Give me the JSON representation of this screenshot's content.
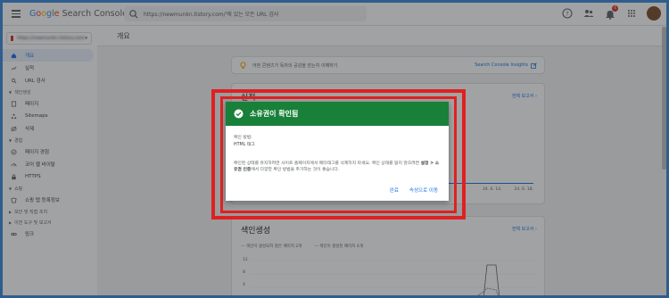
{
  "app": {
    "logo_text": "Google Search Console",
    "search_placeholder": "https://newmunkn.tistory.com/'에 있는 모든 URL 검사"
  },
  "header_icons": [
    "help-icon",
    "people-icon",
    "notifications-icon",
    "apps-icon",
    "avatar"
  ],
  "notification_count": "4",
  "property": {
    "name": "https://newmunkn.tistory.com/"
  },
  "sidebar": {
    "items": [
      {
        "label": "개요",
        "icon": "home-icon",
        "active": true
      },
      {
        "label": "실적",
        "icon": "trending-icon",
        "active": false
      },
      {
        "label": "URL 검사",
        "icon": "search-icon",
        "active": false
      }
    ],
    "sections": [
      {
        "label": "색인생성",
        "items": [
          {
            "label": "페이지",
            "icon": "pages-icon"
          },
          {
            "label": "Sitemaps",
            "icon": "sitemap-icon"
          },
          {
            "label": "삭제",
            "icon": "remove-icon"
          }
        ]
      },
      {
        "label": "경험",
        "items": [
          {
            "label": "페이지 경험",
            "icon": "experience-icon"
          },
          {
            "label": "코어 웹 바이탈",
            "icon": "gauge-icon"
          },
          {
            "label": "HTTPS",
            "icon": "lock-icon"
          }
        ]
      },
      {
        "label": "쇼핑",
        "items": [
          {
            "label": "쇼핑 탭 등록정보",
            "icon": "shopping-icon"
          }
        ]
      },
      {
        "label": "보안 및 직접 조치",
        "items": []
      },
      {
        "label": "이전 도구 및 보고서",
        "items": []
      }
    ],
    "last_item": {
      "label": "링크",
      "icon": "link-icon"
    }
  },
  "main": {
    "page_title": "개요",
    "tip": {
      "text": "어떤 콘텐츠가 독자의 공감을 얻는지 이해하기",
      "link": "Search Console Insights"
    },
    "performance": {
      "title": "실적",
      "link": "전체 보고서",
      "x_ticks": [
        "24. 6. 14.",
        "24. 6. 18."
      ]
    },
    "indexing": {
      "title": "색인생성",
      "link": "전체 보고서",
      "legend": [
        "색인이 생성되지 않은 페이지 2개",
        "색인이 생성된 페이지 4개"
      ],
      "y_ticks": [
        "12",
        "8",
        "4"
      ]
    }
  },
  "dialog": {
    "title": "소유권이 확인됨",
    "method_label": "확인 방법:",
    "method_value": "HTML 태그",
    "body_pre": "확인된 상태를 유지하려면 사이트 홈페이지에서 메타태그를 삭제하지 마세요. 확인 상태를 잃지 않으려면 ",
    "body_bold": "설정 > 소유권 인증",
    "body_post": "에서 다양한 확인 방법을 추가하는 것이 좋습니다.",
    "done_button": "완료",
    "goto_button": "속성으로 이동"
  },
  "colors": {
    "dialog_header": "#188038",
    "highlight": "#e02020",
    "link": "#1a73e8"
  }
}
